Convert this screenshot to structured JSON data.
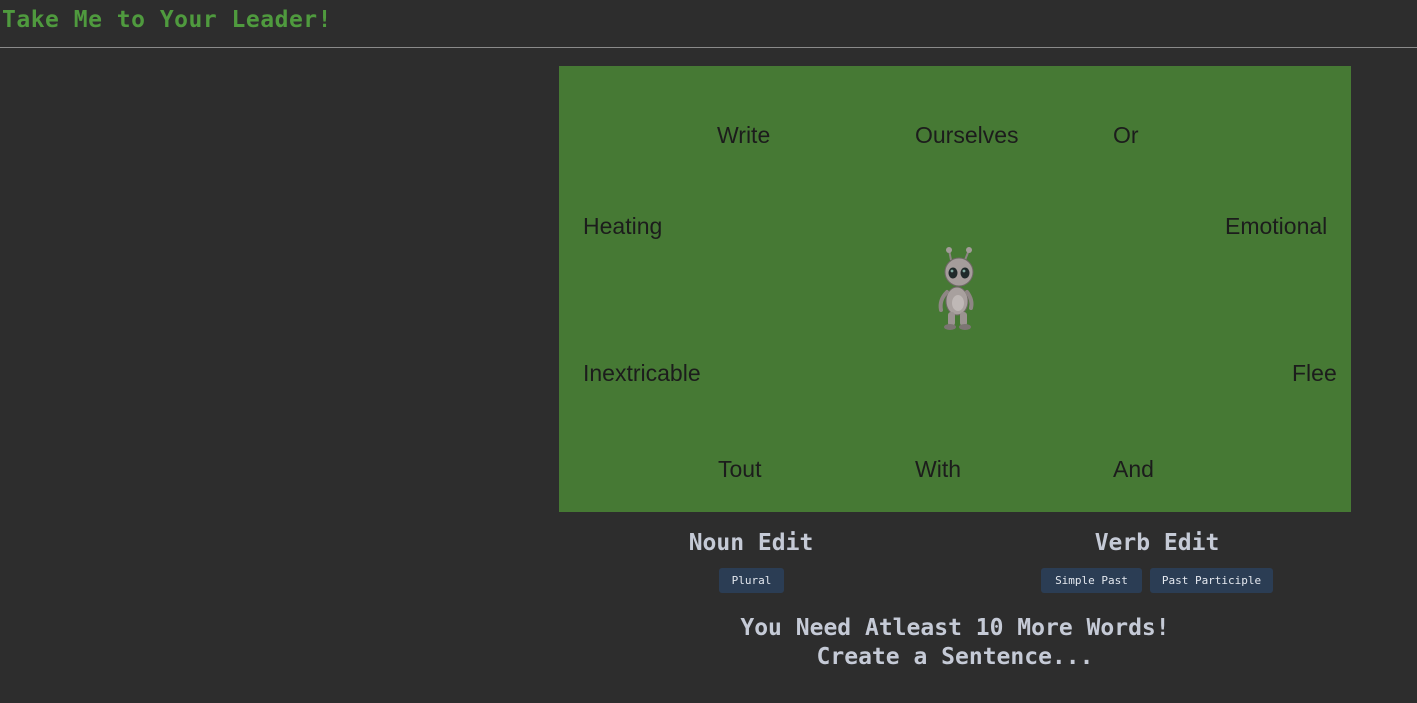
{
  "colors": {
    "background": "#2d2d2d",
    "title": "#4f9a3e",
    "board": "#467934",
    "button": "#2b3d54",
    "text_light": "#c5cad6"
  },
  "header": {
    "title": "Take Me to Your Leader!"
  },
  "board": {
    "words": {
      "top": [
        "Write",
        "Ourselves",
        "Or"
      ],
      "left_upper": "Heating",
      "right_upper": "Emotional",
      "left_lower": "Inextricable",
      "right_lower": "Flee",
      "bottom": [
        "Tout",
        "With",
        "And"
      ]
    },
    "player_icon": "alien-icon"
  },
  "noun_edit": {
    "heading": "Noun Edit",
    "buttons": [
      "Plural"
    ]
  },
  "verb_edit": {
    "heading": "Verb Edit",
    "buttons": [
      "Simple Past",
      "Past Participle"
    ]
  },
  "status": {
    "line1": "You Need Atleast 10 More Words!",
    "line2": "Create a Sentence..."
  }
}
